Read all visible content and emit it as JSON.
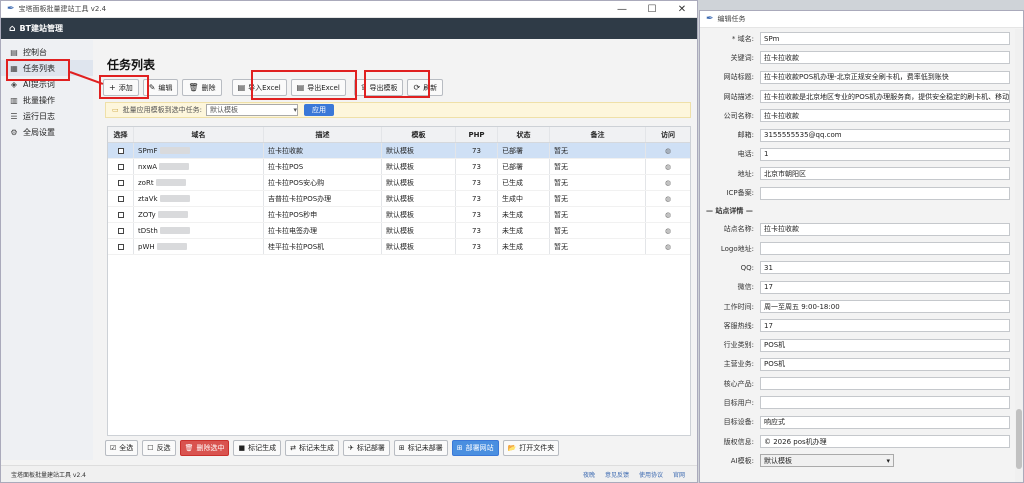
{
  "main_window": {
    "title": "宝塔面板批量建站工具 v2.4",
    "brand": "BT建站管理",
    "controls": [
      "—",
      "☐",
      "✕"
    ]
  },
  "sidebar": {
    "items": [
      {
        "label": "控制台",
        "icon": "dashboard-icon",
        "glyph": "▤"
      },
      {
        "label": "任务列表",
        "icon": "list-icon",
        "glyph": "▦"
      },
      {
        "label": "AI提示词",
        "icon": "ai-icon",
        "glyph": "◈"
      },
      {
        "label": "批量操作",
        "icon": "batch-icon",
        "glyph": "▥"
      },
      {
        "label": "运行日志",
        "icon": "log-icon",
        "glyph": "☰"
      },
      {
        "label": "全局设置",
        "icon": "settings-icon",
        "glyph": "⚙"
      }
    ]
  },
  "page": {
    "title": "任务列表"
  },
  "toolbar": {
    "buttons": [
      {
        "label": "添加",
        "icon": "+"
      },
      {
        "label": "编辑",
        "icon": "✎"
      },
      {
        "label": "删除",
        "icon": "🗑"
      },
      {
        "label": "导入Excel",
        "icon": "▤"
      },
      {
        "label": "导出Excel",
        "icon": "▤"
      },
      {
        "label": "导出模板",
        "icon": "⇪"
      },
      {
        "label": "刷新",
        "icon": "⟳"
      }
    ]
  },
  "banner": {
    "text": "批量应用模板到选中任务:",
    "select_value": "默认模板",
    "apply_label": "应用"
  },
  "table": {
    "headers": [
      "选择",
      "域名",
      "描述",
      "模板",
      "PHP",
      "状态",
      "备注",
      "访问"
    ],
    "rows": [
      {
        "domain": "SPmF",
        "desc": "拉卡拉收款",
        "tpl": "默认模板",
        "php": "73",
        "status": "已部署",
        "note": "暂无",
        "selected": true
      },
      {
        "domain": "nxwA",
        "desc": "拉卡拉POS",
        "tpl": "默认模板",
        "php": "73",
        "status": "已部署",
        "note": "暂无",
        "selected": false
      },
      {
        "domain": "zoRt",
        "desc": "拉卡拉POS安心购",
        "tpl": "默认模板",
        "php": "73",
        "status": "已生成",
        "note": "暂无",
        "selected": false
      },
      {
        "domain": "ztaVk",
        "desc": "吉普拉卡拉POS办理",
        "tpl": "默认模板",
        "php": "73",
        "status": "生成中",
        "note": "暂无",
        "selected": false
      },
      {
        "domain": "ZOTy",
        "desc": "拉卡拉POS秒申",
        "tpl": "默认模板",
        "php": "73",
        "status": "未生成",
        "note": "暂无",
        "selected": false
      },
      {
        "domain": "tDSth",
        "desc": "拉卡拉电签办理",
        "tpl": "默认模板",
        "php": "73",
        "status": "未生成",
        "note": "暂无",
        "selected": false
      },
      {
        "domain": "pWH",
        "desc": "桂平拉卡拉POS机",
        "tpl": "默认模板",
        "php": "73",
        "status": "未生成",
        "note": "暂无",
        "selected": false
      }
    ]
  },
  "bottombar": {
    "buttons": [
      {
        "label": "全选",
        "icon": "☑",
        "style": ""
      },
      {
        "label": "反选",
        "icon": "☐",
        "style": ""
      },
      {
        "label": "删除选中",
        "icon": "🗑",
        "style": "red"
      },
      {
        "label": "标记生成",
        "icon": "■",
        "style": ""
      },
      {
        "label": "标记未生成",
        "icon": "⇄",
        "style": ""
      },
      {
        "label": "标记部署",
        "icon": "✈",
        "style": ""
      },
      {
        "label": "标记未部署",
        "icon": "⊞",
        "style": ""
      },
      {
        "label": "部署网站",
        "icon": "⊞",
        "style": "blue"
      },
      {
        "label": "打开文件夹",
        "icon": "📂",
        "style": ""
      }
    ]
  },
  "statusbar": {
    "text": "宝塔面板批量建站工具 v2.4",
    "links": [
      "夜晚",
      "意见反馈",
      "使用协议",
      "官网"
    ]
  },
  "edit_window": {
    "title": "编辑任务",
    "fields": [
      {
        "label": "* 域名:",
        "value": "SPm"
      },
      {
        "label": "关键词:",
        "value": "拉卡拉收款"
      },
      {
        "label": "网站标题:",
        "value": "拉卡拉收款POS机办理-北京正规安全刷卡机，费率低到账快"
      },
      {
        "label": "网站描述:",
        "value": "拉卡拉收款是北京地区专业的POS机办理服务商，提供安全稳定的刷卡机、移动P"
      },
      {
        "label": "公司名称:",
        "value": "拉卡拉收款"
      },
      {
        "label": "邮箱:",
        "value": "3155555535@qq.com"
      },
      {
        "label": "电话:",
        "value": "1"
      },
      {
        "label": "地址:",
        "value": "北京市朝阳区"
      },
      {
        "label": "ICP备案:",
        "value": ""
      }
    ],
    "section_title": "— 站点详情 —",
    "details": [
      {
        "label": "站点名称:",
        "value": "拉卡拉收款"
      },
      {
        "label": "Logo地址:",
        "value": ""
      },
      {
        "label": "QQ:",
        "value": "31"
      },
      {
        "label": "微信:",
        "value": "17"
      },
      {
        "label": "工作时间:",
        "value": "周一至周五 9:00-18:00"
      },
      {
        "label": "客服热线:",
        "value": "17"
      },
      {
        "label": "行业类别:",
        "value": "POS机"
      },
      {
        "label": "主营业务:",
        "value": "POS机"
      },
      {
        "label": "核心产品:",
        "value": ""
      },
      {
        "label": "目标用户:",
        "value": ""
      },
      {
        "label": "目标设备:",
        "value": "响应式"
      },
      {
        "label": "版权信息:",
        "value": "© 2026 pos机办理"
      }
    ],
    "ai_template_label": "AI模板:",
    "ai_template_value": "默认模板"
  }
}
